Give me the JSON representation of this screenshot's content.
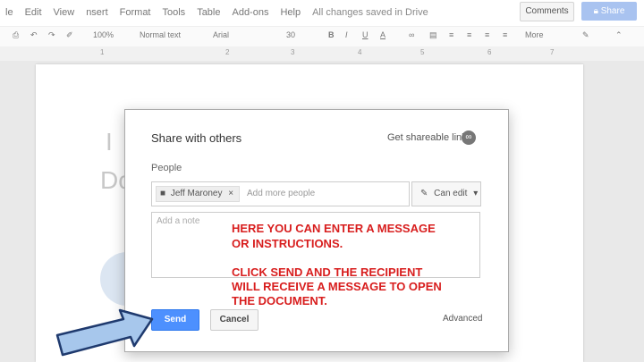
{
  "menu": [
    "le",
    "Edit",
    "View",
    "nsert",
    "Format",
    "Tools",
    "Table",
    "Add-ons",
    "Help"
  ],
  "saved_status": "All changes saved in Drive",
  "header": {
    "comments_label": "Comments",
    "share_label": "Share"
  },
  "toolbar": {
    "zoom": "100%",
    "style": "Normal text",
    "font": "Arial",
    "size": "30",
    "bold": "B",
    "italic": "I",
    "underline": "U",
    "text_color": "A",
    "more": "More"
  },
  "ruler": [
    "1",
    "2",
    "3",
    "4",
    "5",
    "6",
    "7"
  ],
  "background_text": {
    "line1": "I",
    "line2": "Do"
  },
  "dialog": {
    "title": "Share with others",
    "get_link": "Get shareable link",
    "people_label": "People",
    "chip_name": "Jeff Maroney",
    "add_more_placeholder": "Add more people",
    "permission": "Can edit",
    "note_placeholder": "Add a note",
    "send_label": "Send",
    "cancel_label": "Cancel",
    "advanced_label": "Advanced"
  },
  "overlay": {
    "line1": "HERE YOU CAN ENTER A MESSAGE",
    "line2": "OR INSTRUCTIONS.",
    "line3": "CLICK SEND AND THE RECIPIENT",
    "line4": "WILL RECEIVE A MESSAGE TO OPEN",
    "line5": "THE DOCUMENT."
  },
  "colors": {
    "accent": "#4d90fe",
    "overlay_text": "#d81e1e",
    "arrow_fill": "#a7c7ec"
  }
}
